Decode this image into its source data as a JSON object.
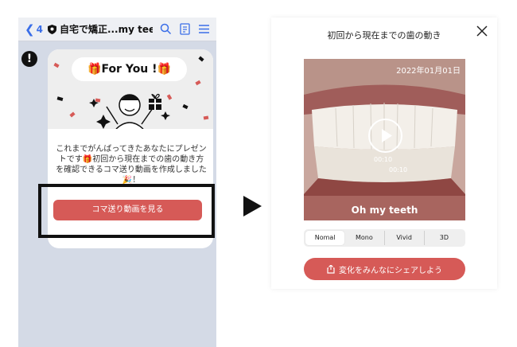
{
  "left_screen": {
    "back_count": "4",
    "header_title": "自宅で矯正...my teeth",
    "card": {
      "banner": "🎁For You !🎁",
      "message": "これまでがんばってきたあなたにプレゼントです🎁初回から現在までの歯の動き方を確認できるコマ送り動画を作成しました🎉！",
      "button_label": "コマ送り動画を見る"
    }
  },
  "right_screen": {
    "title": "初回から現在までの歯の動き",
    "date": "2022年01月01日",
    "time_a": "00:10",
    "time_b": "00:10",
    "brand": "Oh my teeth",
    "filters": [
      "Nomal",
      "Mono",
      "Vivid",
      "3D"
    ],
    "active_filter": "Nomal",
    "share_label": "変化をみんなにシェアしよう"
  },
  "colors": {
    "accent_red": "#d65a57",
    "link_blue": "#3a6ee8",
    "chat_background": "#d4dae6"
  },
  "icons": {
    "header": [
      "chevron-left-icon",
      "shield-icon",
      "search-icon",
      "note-icon",
      "menu-icon"
    ],
    "alert": "exclamation-icon",
    "close": "close-icon",
    "play": "play-icon",
    "share": "share-icon"
  }
}
